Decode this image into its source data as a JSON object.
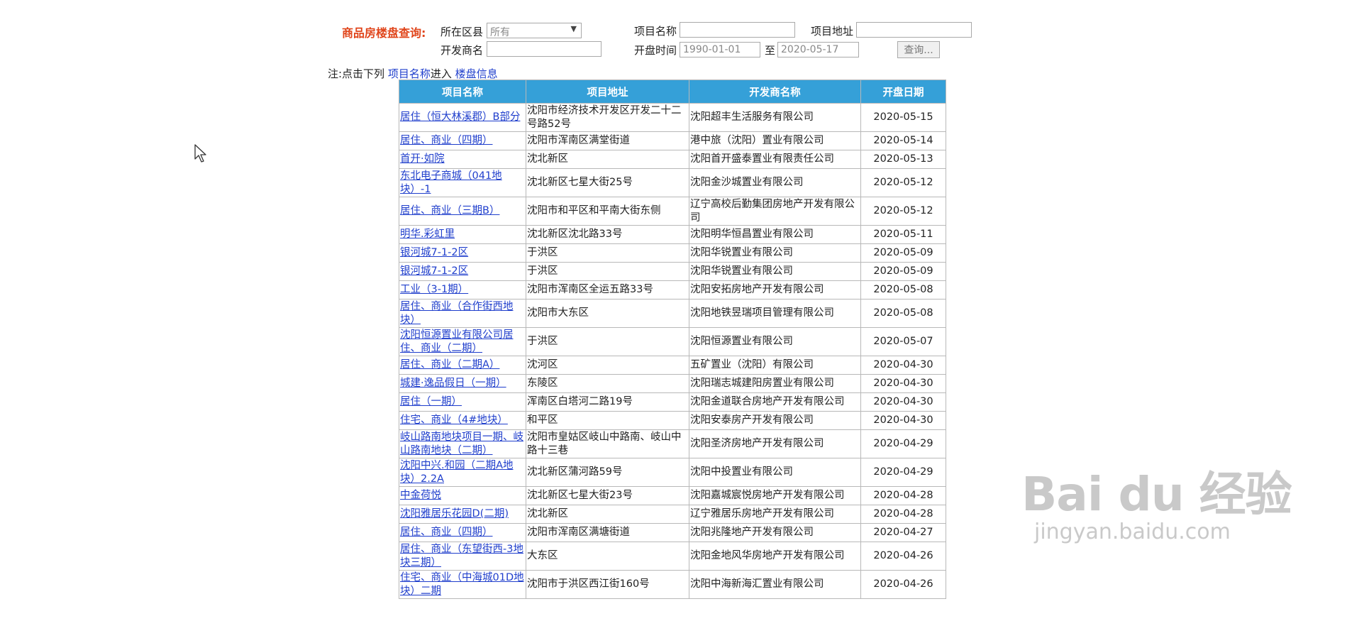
{
  "search": {
    "title": "商品房楼盘查询:",
    "district_label": "所在区县",
    "district_value": "所有",
    "project_name_label": "项目名称",
    "project_address_label": "项目地址",
    "developer_label": "开发商名",
    "open_time_label": "开盘时间",
    "date_from": "1990-01-01",
    "to_label": "至",
    "date_to": "2020-05-17",
    "query_button": "查询..."
  },
  "note": {
    "prefix": "注:点击下列",
    "link_text": "项目名称",
    "middle": "进入",
    "suffix_link": "楼盘信息"
  },
  "table": {
    "headers": [
      "项目名称",
      "项目地址",
      "开发商名称",
      "开盘日期"
    ],
    "rows": [
      {
        "name": "居住（恒大林溪郡）B部分",
        "address": "沈阳市经济技术开发区开发二十二号路52号",
        "developer": "沈阳超丰生活服务有限公司",
        "date": "2020-05-15"
      },
      {
        "name": "居住、商业（四期）",
        "address": "沈阳市浑南区满堂街道",
        "developer": "港中旅（沈阳）置业有限公司",
        "date": "2020-05-14"
      },
      {
        "name": "首开·如院",
        "address": "沈北新区",
        "developer": "沈阳首开盛泰置业有限责任公司",
        "date": "2020-05-13"
      },
      {
        "name": "东北电子商城（041地块）-1",
        "address": "沈北新区七星大街25号",
        "developer": "沈阳金沙城置业有限公司",
        "date": "2020-05-12"
      },
      {
        "name": "居住、商业（三期B）",
        "address": "沈阳市和平区和平南大街东侧",
        "developer": "辽宁高校后勤集团房地产开发有限公司",
        "date": "2020-05-12"
      },
      {
        "name": "明华.彩虹里",
        "address": "沈北新区沈北路33号",
        "developer": "沈阳明华恒昌置业有限公司",
        "date": "2020-05-11"
      },
      {
        "name": "银河城7-1-2区",
        "address": "于洪区",
        "developer": "沈阳华锐置业有限公司",
        "date": "2020-05-09"
      },
      {
        "name": "银河城7-1-2区",
        "address": "于洪区",
        "developer": "沈阳华锐置业有限公司",
        "date": "2020-05-09"
      },
      {
        "name": "工业（3-1期）",
        "address": "沈阳市浑南区全运五路33号",
        "developer": "沈阳安拓房地产开发有限公司",
        "date": "2020-05-08"
      },
      {
        "name": "居住、商业（合作街西地块）",
        "address": "沈阳市大东区",
        "developer": "沈阳地铁昱瑞项目管理有限公司",
        "date": "2020-05-08"
      },
      {
        "name": "沈阳恒源置业有限公司居住、商业（二期）",
        "address": "于洪区",
        "developer": "沈阳恒源置业有限公司",
        "date": "2020-05-07"
      },
      {
        "name": "居住、商业（二期A）",
        "address": "沈河区",
        "developer": "五矿置业（沈阳）有限公司",
        "date": "2020-04-30"
      },
      {
        "name": "城建·逸品假日（一期）",
        "address": "东陵区",
        "developer": "沈阳瑞志城建阳房置业有限公司",
        "date": "2020-04-30"
      },
      {
        "name": "居住（一期）",
        "address": "浑南区白塔河二路19号",
        "developer": "沈阳金道联合房地产开发有限公司",
        "date": "2020-04-30"
      },
      {
        "name": "住宅、商业（4#地块）",
        "address": "和平区",
        "developer": "沈阳安泰房产开发有限公司",
        "date": "2020-04-30"
      },
      {
        "name": "岐山路南地块项目一期、岐山路南地块（二期）",
        "address": "沈阳市皇姑区岐山中路南、岐山中路十三巷",
        "developer": "沈阳圣济房地产开发有限公司",
        "date": "2020-04-29"
      },
      {
        "name": "沈阳中兴.和园（二期A地块）2.2A",
        "address": "沈北新区蒲河路59号",
        "developer": "沈阳中投置业有限公司",
        "date": "2020-04-29"
      },
      {
        "name": "中金荷悦",
        "address": "沈北新区七星大街23号",
        "developer": "沈阳嘉城宸悦房地产开发有限公司",
        "date": "2020-04-28"
      },
      {
        "name": "沈阳雅居乐花园D(二期)",
        "address": "沈北新区",
        "developer": "辽宁雅居乐房地产开发有限公司",
        "date": "2020-04-28"
      },
      {
        "name": "居住、商业（四期）",
        "address": "沈阳市浑南区满塘街道",
        "developer": "沈阳兆隆地产开发有限公司",
        "date": "2020-04-27"
      },
      {
        "name": "居住、商业（东望街西-3地块三期）",
        "address": "大东区",
        "developer": "沈阳金地风华房地产开发有限公司",
        "date": "2020-04-26"
      },
      {
        "name": "住宅、商业（中海城01D地块）二期",
        "address": "沈阳市于洪区西江街160号",
        "developer": "沈阳中海新海汇置业有限公司",
        "date": "2020-04-26"
      }
    ]
  },
  "watermark": {
    "brand": "Bai du 经验",
    "url": "jingyan.baidu.com"
  },
  "icons": {
    "cursor": "mouse-pointer-icon",
    "dropdown": "chevron-down-icon"
  }
}
